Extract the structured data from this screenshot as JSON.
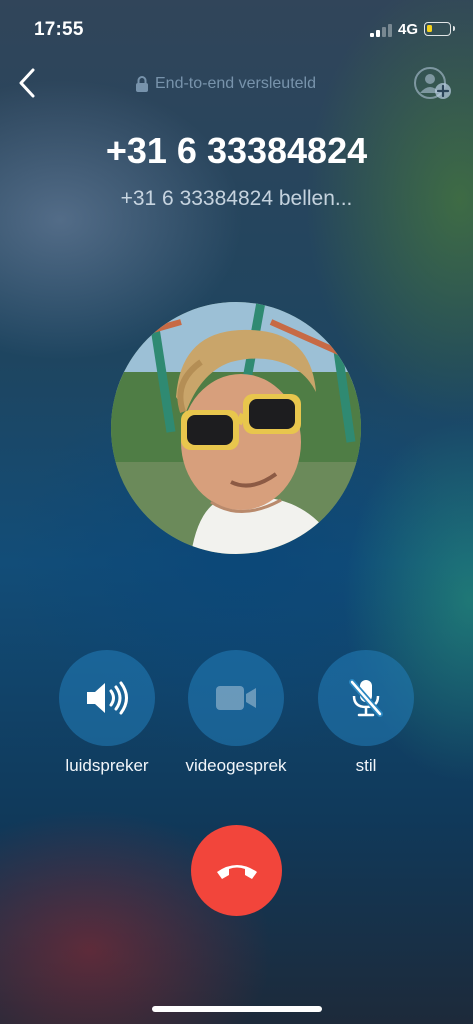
{
  "status_bar": {
    "time": "17:55",
    "network": "4G",
    "signal_bars": 2,
    "signal_total": 4,
    "battery_level": 0.25,
    "battery_color": "#f4d21c"
  },
  "header": {
    "back_icon": "chevron-left-icon",
    "encryption_icon": "lock-icon",
    "encryption_text": "End-to-end versleuteld",
    "add_participant_icon": "add-person-icon"
  },
  "call": {
    "title": "+31 6 33384824",
    "status": "+31 6 33384824 bellen..."
  },
  "controls": [
    {
      "id": "speaker",
      "icon": "speaker-icon",
      "label": "luidspreker"
    },
    {
      "id": "video",
      "icon": "video-camera-icon",
      "label": "videogesprek"
    },
    {
      "id": "mute",
      "icon": "mic-off-icon",
      "label": "stil"
    }
  ],
  "end_call": {
    "icon": "phone-hangup-icon",
    "color": "#f2453b"
  },
  "colors": {
    "control_bg": "#237db9",
    "accent_red": "#f2453b"
  }
}
